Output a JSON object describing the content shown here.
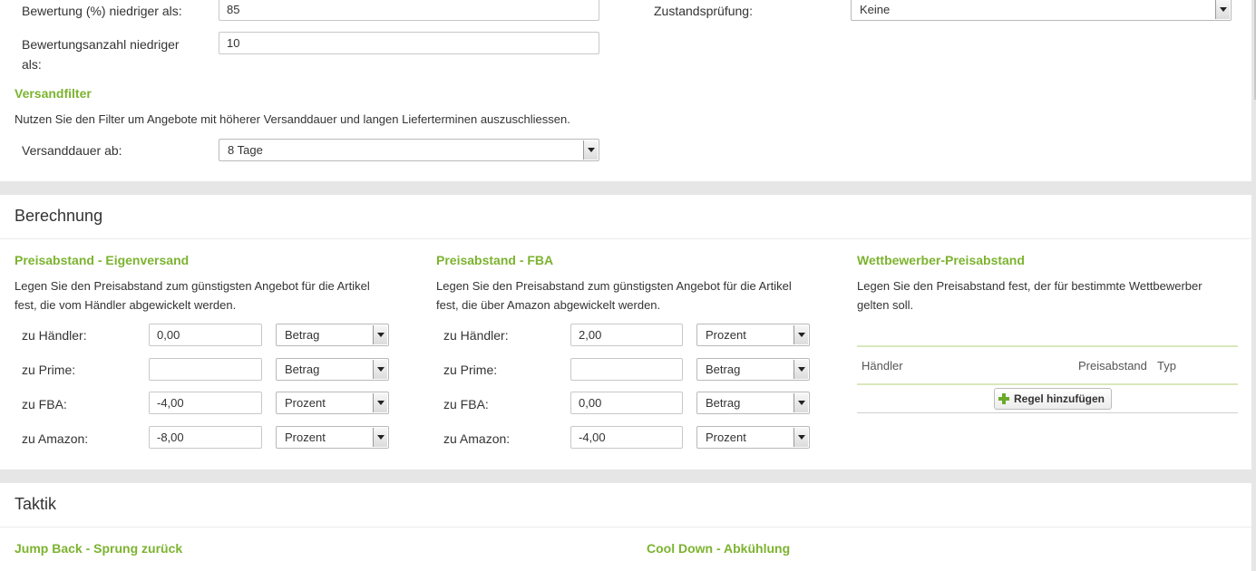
{
  "filter": {
    "rating_label": "Bewertung (%) niedriger als:",
    "rating_value": "85",
    "rating_count_label_1": "Bewertungsanzahl niedriger",
    "rating_count_label_2": "als:",
    "rating_count_value": "10",
    "condition_label": "Zustandsprüfung:",
    "condition_value": "Keine",
    "shipping_heading": "Versandfilter",
    "shipping_desc": "Nutzen Sie den Filter um Angebote mit höherer Versanddauer und langen Lieferterminen auszuschliessen.",
    "shipping_label": "Versanddauer ab:",
    "shipping_value": "8 Tage"
  },
  "calculation": {
    "title": "Berechnung",
    "own": {
      "heading": "Preisabstand - Eigenversand",
      "desc_1": "Legen Sie den Preisabstand zum günstigsten Angebot für die Artikel",
      "desc_2": "fest, die vom Händler abgewickelt werden.",
      "rows": [
        {
          "label": "zu Händler:",
          "value": "0,00",
          "type": "Betrag"
        },
        {
          "label": "zu Prime:",
          "value": "",
          "type": "Betrag"
        },
        {
          "label": "zu FBA:",
          "value": "-4,00",
          "type": "Prozent"
        },
        {
          "label": "zu Amazon:",
          "value": "-8,00",
          "type": "Prozent"
        }
      ]
    },
    "fba": {
      "heading": "Preisabstand - FBA",
      "desc_1": "Legen Sie den Preisabstand zum günstigsten Angebot für die Artikel",
      "desc_2": "fest, die über Amazon abgewickelt werden.",
      "rows": [
        {
          "label": "zu Händler:",
          "value": "2,00",
          "type": "Prozent"
        },
        {
          "label": "zu Prime:",
          "value": "",
          "type": "Betrag"
        },
        {
          "label": "zu FBA:",
          "value": "0,00",
          "type": "Betrag"
        },
        {
          "label": "zu Amazon:",
          "value": "-4,00",
          "type": "Prozent"
        }
      ]
    },
    "competitor": {
      "heading": "Wettbewerber-Preisabstand",
      "desc_1": "Legen Sie den Preisabstand fest, der für bestimmte Wettbewerber",
      "desc_2": "gelten soll.",
      "col_dealer": "Händler",
      "col_gap": "Preisabstand",
      "col_type": "Typ",
      "add_button": "Regel hinzufügen"
    }
  },
  "tactic": {
    "title": "Taktik",
    "jump_back": "Jump Back - Sprung zurück",
    "cool_down": "Cool Down - Abkühlung"
  },
  "colors": {
    "accent_green": "#7cb32f",
    "page_background": "#e6e6e6"
  }
}
